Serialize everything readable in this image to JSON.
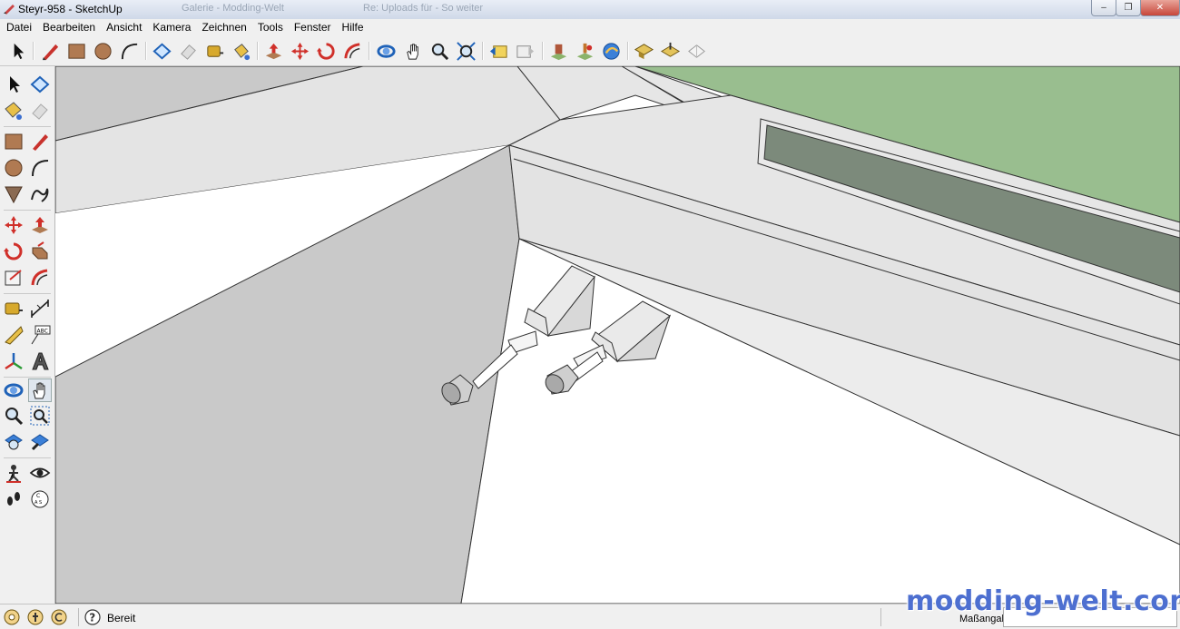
{
  "window": {
    "title": "Steyr-958 - SketchUp",
    "background_tabs": [
      "",
      "Galerie - Modding-Welt",
      "Re: Uploads für - So weiter"
    ],
    "controls": {
      "minimize": "–",
      "maximize": "❐",
      "close": "✕"
    }
  },
  "menu": [
    "Datei",
    "Bearbeiten",
    "Ansicht",
    "Kamera",
    "Zeichnen",
    "Tools",
    "Fenster",
    "Hilfe"
  ],
  "toolbar_icons": [
    "select-icon",
    "pencil-icon",
    "rectangle-icon",
    "circle-icon",
    "arc-icon",
    "make-component-icon",
    "eraser-icon",
    "tape-measure-icon",
    "paint-bucket-icon",
    "push-pull-icon",
    "move-icon",
    "rotate-icon",
    "offset-icon",
    "orbit-icon",
    "pan-icon",
    "zoom-icon",
    "zoom-extents-icon",
    "previous-view-icon",
    "next-view-icon",
    "place-model-icon",
    "get-models-icon",
    "share-model-icon",
    "add-location-icon",
    "toggle-terrain-icon",
    "get-photo-texture-icon"
  ],
  "left_tools": [
    "select",
    "make-component",
    "paint-bucket",
    "eraser",
    "rectangle",
    "pencil",
    "circle",
    "arc",
    "polygon",
    "freehand",
    "move",
    "push-pull",
    "rotate",
    "follow-me",
    "scale",
    "offset",
    "tape-measure",
    "dimension",
    "protractor",
    "text",
    "axes",
    "3d-text",
    "orbit",
    "pan",
    "zoom",
    "zoom-window",
    "zoom-extents",
    "previous-view",
    "position-camera",
    "look-around",
    "walk",
    "section-plane"
  ],
  "status": {
    "text": "Bereit",
    "measure_label": "Maßangaben",
    "measure_value": ""
  },
  "watermark": "modding-welt.com",
  "colors": {
    "ground": "#99be8f",
    "wall_shadow": "#c9c9c9",
    "wall_light": "#e4e4e4",
    "slot": "#7c8a7b"
  }
}
